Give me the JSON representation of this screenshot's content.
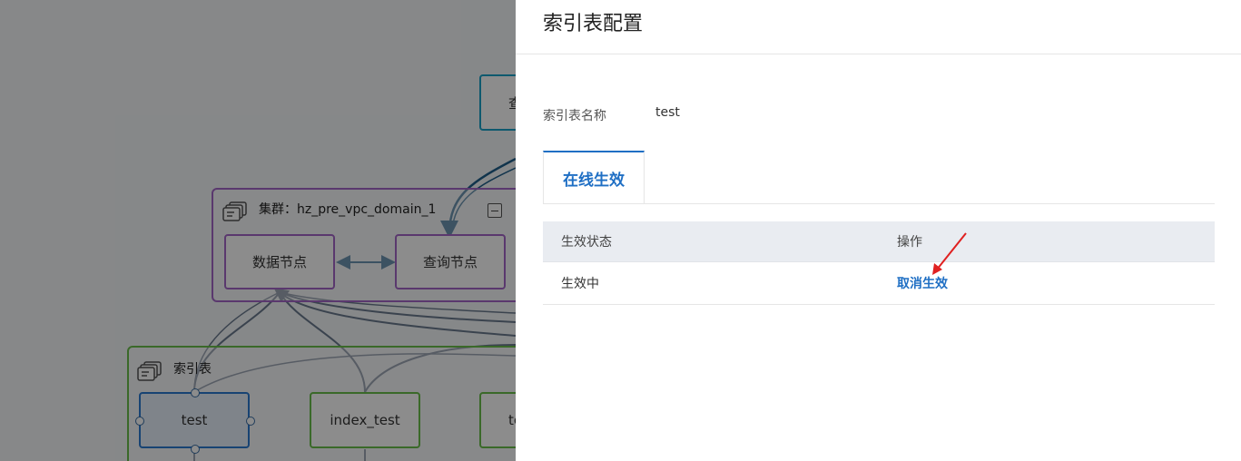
{
  "canvas": {
    "cluster_group": {
      "title": "集群：hz_pre_vpc_domain_1",
      "nodes": {
        "data_node": "数据节点",
        "query_node": "查询节点"
      }
    },
    "top_node_label": "查",
    "index_group": {
      "title": "索引表",
      "nodes": {
        "test": "test",
        "index_test": "index_test",
        "partial": "te"
      }
    }
  },
  "drawer": {
    "title": "索引表配置",
    "field": {
      "label": "索引表名称",
      "value": "test"
    },
    "tabs": [
      {
        "label": "在线生效",
        "active": true
      }
    ],
    "table": {
      "headers": [
        "生效状态",
        "操作"
      ],
      "rows": [
        {
          "status": "生效中",
          "action": "取消生效"
        }
      ]
    }
  },
  "colors": {
    "accent": "#1f6fc4",
    "cluster_border": "#9b59b6",
    "index_border": "#6abf4b",
    "query_border": "#1aa3c9",
    "annotation_arrow": "#e02020"
  }
}
